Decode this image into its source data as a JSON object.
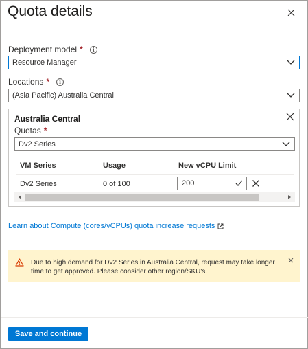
{
  "dialog": {
    "title": "Quota details"
  },
  "deployment_model": {
    "label": "Deployment model",
    "required_mark": "*",
    "info_icon": "i",
    "value": "Resource Manager"
  },
  "locations": {
    "label": "Locations",
    "required_mark": "*",
    "info_icon": "i",
    "value": "(Asia Pacific) Australia Central"
  },
  "panel": {
    "title": "Australia Central",
    "quotas_label": "Quotas",
    "required_mark": "*",
    "quotas_value": "Dv2 Series",
    "table": {
      "headers": [
        "VM Series",
        "Usage",
        "New vCPU Limit"
      ],
      "rows": [
        {
          "vm_series": "Dv2 Series",
          "usage": "0 of 100",
          "new_limit": "200"
        }
      ]
    }
  },
  "learn_link": "Learn about Compute (cores/vCPUs) quota increase requests",
  "warning": {
    "message": "Due to high demand for Dv2 Series in Australia Central, request may take longer time to get approved. Please consider other region/SKU's."
  },
  "footer": {
    "primary_button": "Save and continue"
  },
  "colors": {
    "accent": "#0078d4",
    "warning_bg": "#fff4ce",
    "warning_icon": "#d83b01",
    "required": "#a4262c"
  },
  "icons": [
    "close-icon",
    "info-icon",
    "chevron-down-icon",
    "check-icon",
    "external-link-icon",
    "warning-icon",
    "scroll-left-icon",
    "scroll-right-icon"
  ]
}
